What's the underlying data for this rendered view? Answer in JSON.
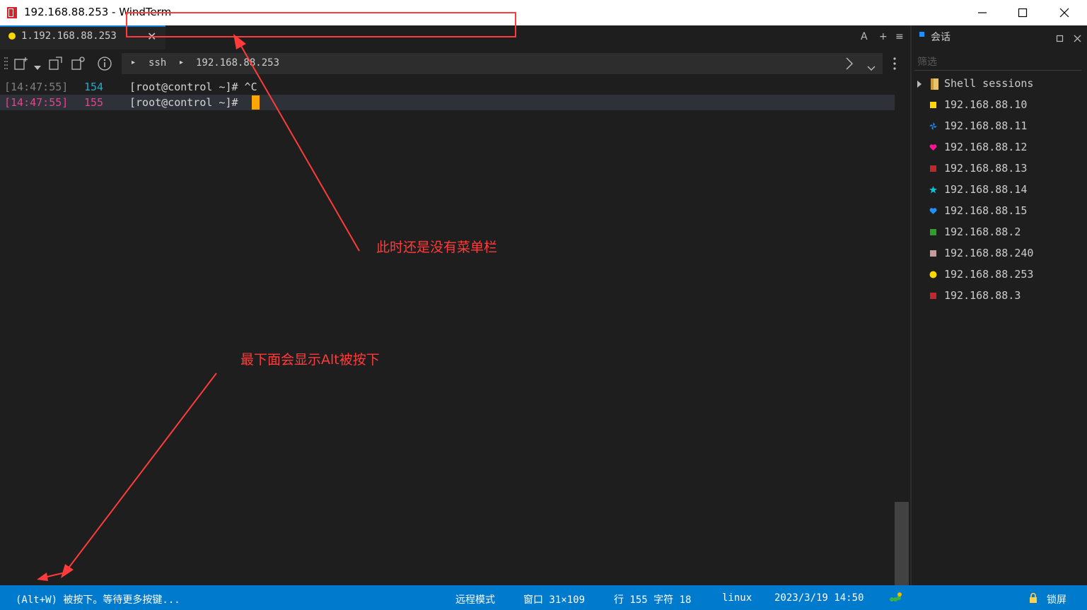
{
  "window": {
    "title": "192.168.88.253 - WindTerm",
    "minimize_icon": "minimize-icon",
    "maximize_icon": "maximize-icon",
    "close_icon": "close-icon"
  },
  "tab": {
    "label": "1.192.168.88.253",
    "close_glyph": "✕",
    "dot_color": "#ffd700",
    "tools": [
      "A",
      "+",
      "≡"
    ]
  },
  "address": {
    "protocol": "ssh",
    "host": "192.168.88.253"
  },
  "terminal": {
    "lines": [
      {
        "time": "[14:47:55]",
        "num": "154",
        "text": "[root@control ~]# ^C"
      },
      {
        "time": "[14:47:55]",
        "num": "155",
        "text": "[root@control ~]# "
      }
    ]
  },
  "panel": {
    "title": "会话",
    "filter_placeholder": "筛选",
    "group": "Shell sessions",
    "sessions": [
      {
        "label": "192.168.88.10",
        "color": "#ffd700",
        "icon": "square-icon"
      },
      {
        "label": "192.168.88.11",
        "color": "#1e90ff",
        "icon": "pinwheel-icon"
      },
      {
        "label": "192.168.88.12",
        "color": "#ff1493",
        "icon": "heart-icon"
      },
      {
        "label": "192.168.88.13",
        "color": "#c0282d",
        "icon": "square-icon"
      },
      {
        "label": "192.168.88.14",
        "color": "#00c8d7",
        "icon": "star-icon"
      },
      {
        "label": "192.168.88.15",
        "color": "#1e90ff",
        "icon": "heart-icon"
      },
      {
        "label": "192.168.88.2",
        "color": "#2e9e2e",
        "icon": "square-icon"
      },
      {
        "label": "192.168.88.240",
        "color": "#c69a9a",
        "icon": "square-icon"
      },
      {
        "label": "192.168.88.253",
        "color": "#ffd700",
        "icon": "circle-icon"
      },
      {
        "label": "192.168.88.3",
        "color": "#c0282d",
        "icon": "square-icon"
      }
    ]
  },
  "status": {
    "message": "(Alt+W) 被按下。等待更多按键...",
    "mode": "远程模式",
    "window_size": "窗口 31×109",
    "position": "行 155 字符 18",
    "os": "linux",
    "datetime": "2023/3/19 14:50",
    "lock": "锁屏"
  },
  "annotations": {
    "no_menu": "此时还是没有菜单栏",
    "alt_pressed": "最下面会显示Alt被按下"
  },
  "colors": {
    "accent": "#007acc",
    "annotation": "#ff3b3b"
  }
}
